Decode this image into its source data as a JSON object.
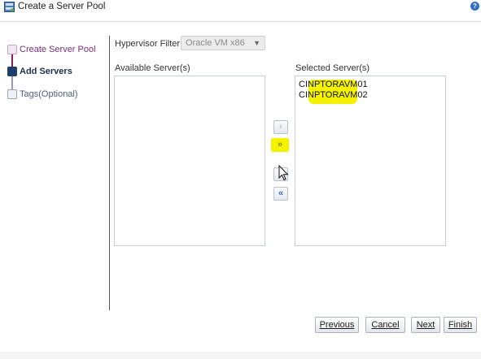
{
  "window": {
    "title": "Create a Server Pool",
    "help_icon": "help-icon"
  },
  "train": {
    "steps": [
      {
        "label": "Create Server Pool",
        "state": "visited"
      },
      {
        "label": "Add Servers",
        "state": "current"
      },
      {
        "label": "Tags(Optional)",
        "state": "upcoming"
      }
    ]
  },
  "filter": {
    "label": "Hypervisor Filter:",
    "value": "Oracle VM x86"
  },
  "available": {
    "label": "Available Server(s)",
    "items": []
  },
  "selected": {
    "label": "Selected Server(s)",
    "items": [
      "CINPTORAVM01",
      "CINPTORAVM02"
    ]
  },
  "shuttle": {
    "move": "move-selected-icon",
    "move_all": "move-all-icon",
    "remove": "remove-selected-icon",
    "remove_all": "remove-all-icon"
  },
  "buttons": {
    "previous": "Previous",
    "cancel": "Cancel",
    "next": "Next",
    "finish": "Finish"
  },
  "colors": {
    "highlight": "#f5f200",
    "trainVisited": "#8d1f58",
    "trainCurrent": "#1d3f6e"
  }
}
